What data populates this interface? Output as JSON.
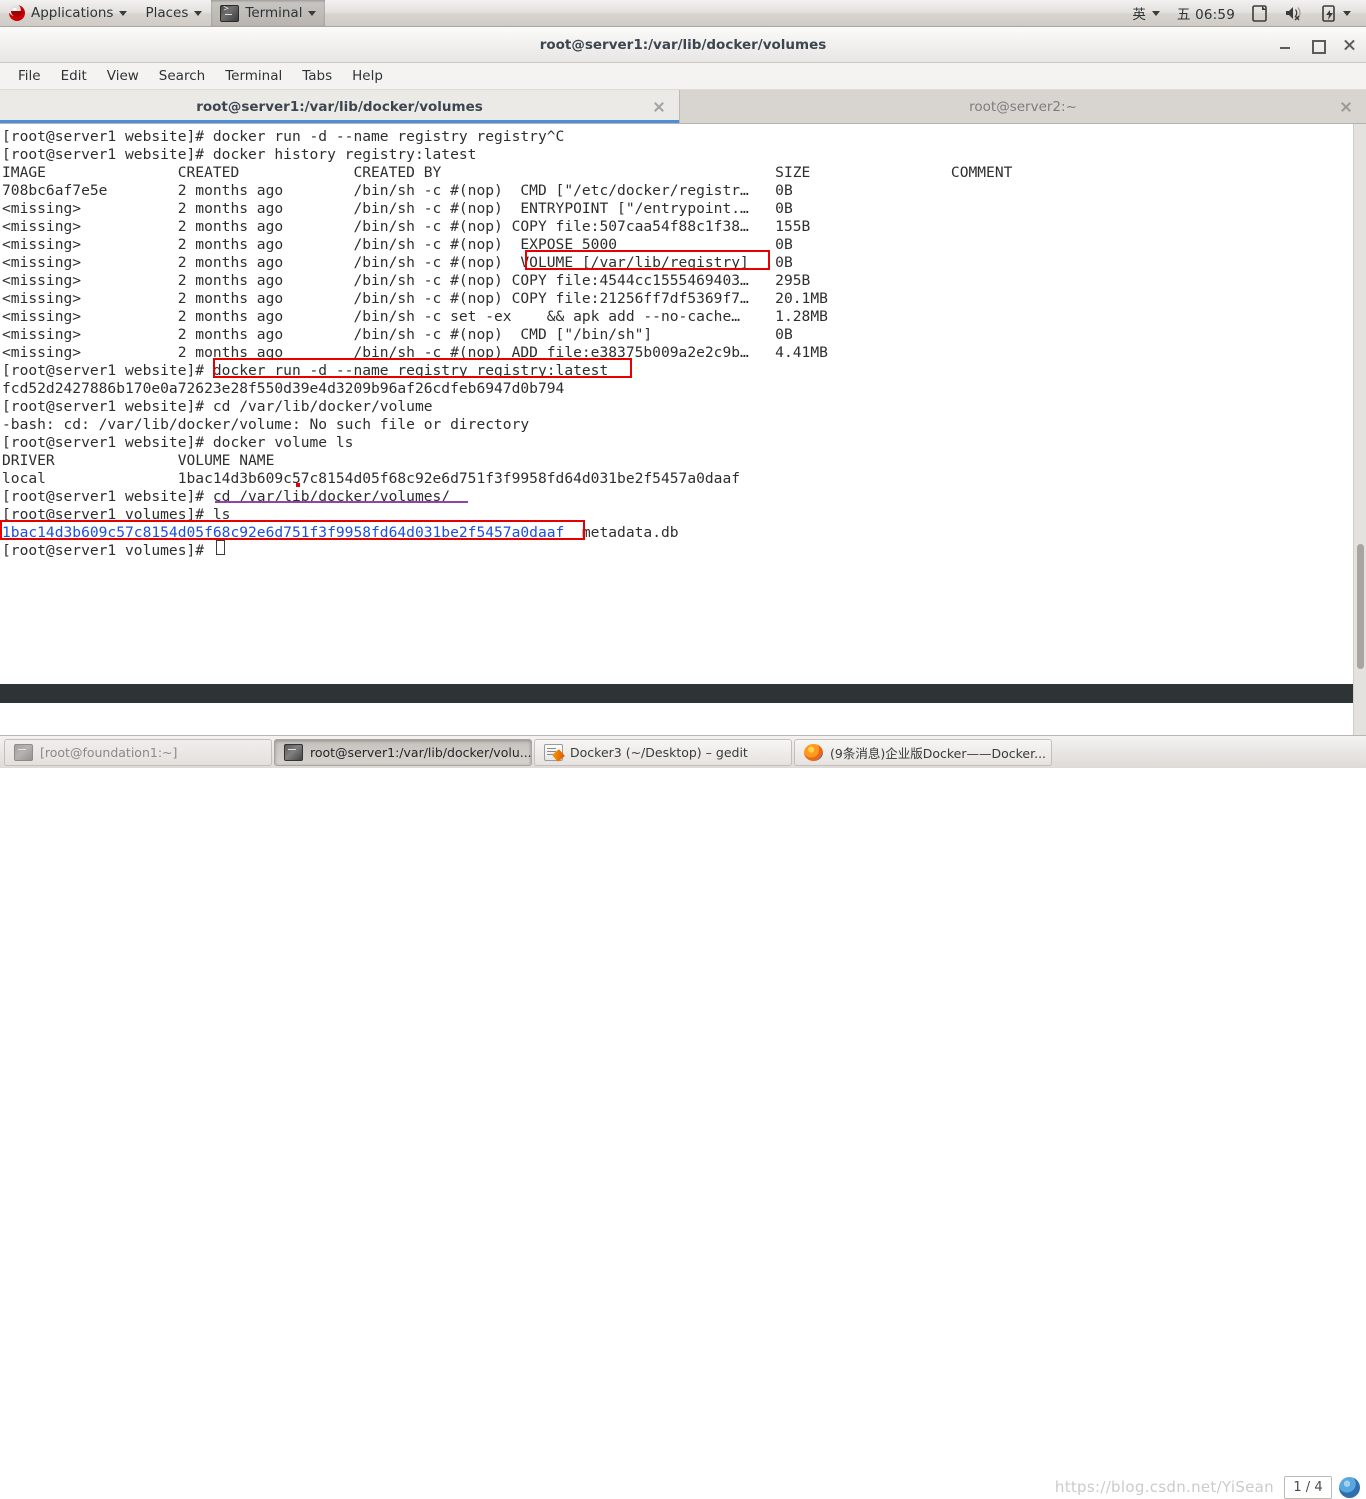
{
  "top_panel": {
    "applications_label": "Applications",
    "places_label": "Places",
    "active_app_label": "Terminal",
    "input_method": "英",
    "clock": "五 06:59",
    "icons": [
      "redhat-logo-icon",
      "chevron-down-icon",
      "terminal-icon",
      "notes-icon",
      "volume-muted-icon",
      "battery-icon",
      "chevron-down-icon"
    ]
  },
  "window": {
    "title": "root@server1:/var/lib/docker/volumes",
    "buttons": {
      "minimize": "minimize-button",
      "maximize": "maximize-button",
      "close": "close-button"
    }
  },
  "menubar": {
    "items": [
      "File",
      "Edit",
      "View",
      "Search",
      "Terminal",
      "Tabs",
      "Help"
    ]
  },
  "tabs": [
    {
      "label": "root@server1:/var/lib/docker/volumes",
      "active": true
    },
    {
      "label": "root@server2:~",
      "active": false
    }
  ],
  "terminal": {
    "lines": [
      "[root@server1 website]# docker run -d --name registry registry^C",
      "[root@server1 website]# docker history registry:latest",
      "IMAGE               CREATED             CREATED BY                                      SIZE                COMMENT",
      "708bc6af7e5e        2 months ago        /bin/sh -c #(nop)  CMD [\"/etc/docker/registr…   0B",
      "<missing>           2 months ago        /bin/sh -c #(nop)  ENTRYPOINT [\"/entrypoint.…   0B",
      "<missing>           2 months ago        /bin/sh -c #(nop) COPY file:507caa54f88c1f38…   155B",
      "<missing>           2 months ago        /bin/sh -c #(nop)  EXPOSE 5000                  0B",
      "<missing>           2 months ago        /bin/sh -c #(nop)  VOLUME [/var/lib/registry]   0B",
      "<missing>           2 months ago        /bin/sh -c #(nop) COPY file:4544cc1555469403…   295B",
      "<missing>           2 months ago        /bin/sh -c #(nop) COPY file:21256ff7df5369f7…   20.1MB",
      "<missing>           2 months ago        /bin/sh -c set -ex    && apk add --no-cache…    1.28MB",
      "<missing>           2 months ago        /bin/sh -c #(nop)  CMD [\"/bin/sh\"]              0B",
      "<missing>           2 months ago        /bin/sh -c #(nop) ADD file:e38375b009a2e2c9b…   4.41MB",
      "[root@server1 website]# docker run -d --name registry registry:latest",
      "fcd52d2427886b170e0a72623e28f550d39e4d3209b96af26cdfeb6947d0b794",
      "[root@server1 website]# cd /var/lib/docker/volume",
      "-bash: cd: /var/lib/docker/volume: No such file or directory",
      "[root@server1 website]# docker volume ls",
      "DRIVER              VOLUME NAME",
      "local               1bac14d3b609c57c8154d05f68c92e6d751f3f9958fd64d031be2f5457a0daaf",
      "[root@server1 website]# cd /var/lib/docker/volumes/",
      "[root@server1 volumes]# ls",
      "",
      "[root@server1 volumes]# "
    ],
    "ls_output": {
      "volume_dir": "1bac14d3b609c57c8154d05f68c92e6d751f3f9958fd64d031be2f5457a0daaf",
      "metadata_file": "metadata.db"
    },
    "annotation_color": "#e60000",
    "underline_color": "#8e44ad",
    "dir_color": "#1a4fe0"
  },
  "taskbar": {
    "tasks": [
      {
        "label": "[root@foundation1:~]",
        "icon": "terminal-icon",
        "state": "inactive"
      },
      {
        "label": "root@server1:/var/lib/docker/volu...",
        "icon": "terminal-icon",
        "state": "pressed"
      },
      {
        "label": "Docker3 (~/Desktop) – gedit",
        "icon": "gedit-icon",
        "state": "normal"
      },
      {
        "label": "(9条消息)企业版Docker——Docker...",
        "icon": "firefox-icon",
        "state": "normal"
      }
    ],
    "watermark": "https://blog.csdn.net/YiSean",
    "pager": "1 / 4",
    "tray_icon": "firefox-tray-icon"
  }
}
